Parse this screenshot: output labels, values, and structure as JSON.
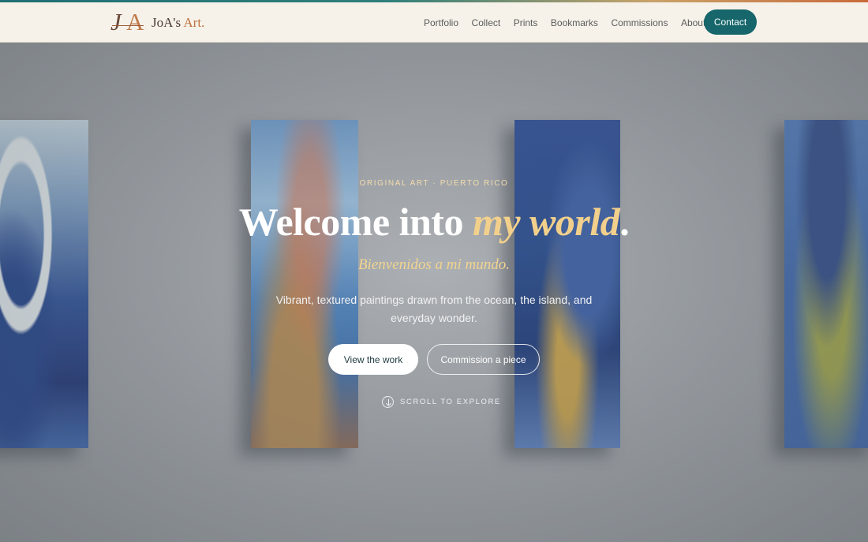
{
  "brand": {
    "mark": "JoA",
    "name_prefix": "JoA's",
    "name_suffix": "Art."
  },
  "nav": {
    "items": [
      "Portfolio",
      "Collect",
      "Prints",
      "Bookmarks",
      "Commissions",
      "About"
    ],
    "contact_label": "Contact"
  },
  "hero": {
    "eyebrow": "ORIGINAL ART · PUERTO RICO",
    "headline_plain": "Welcome into ",
    "headline_emphasis": "my world",
    "headline_end": ".",
    "subtitle_es": "Bienvenidos a mi mundo.",
    "description": "Vibrant, textured paintings drawn from the ocean, the island, and everyday wonder.",
    "primary_button": "View the work",
    "secondary_button": "Commission a piece",
    "scroll_label": "SCROLL TO EXPLORE"
  },
  "colors": {
    "accent": "#16666b",
    "gold": "#f2d08c",
    "header_bg": "#f6f2ea"
  },
  "icons": {
    "scroll": "arrow-down-circle-icon"
  }
}
